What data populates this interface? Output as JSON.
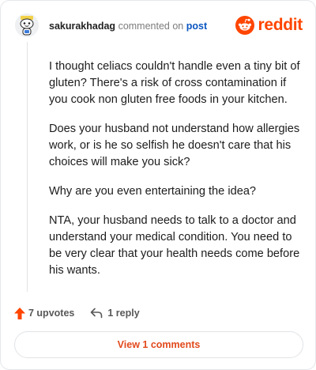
{
  "comment": {
    "author": "sakurakhadag",
    "action_text": "commented on",
    "post_link": "post",
    "avatar_icon": "snoo-avatar",
    "brand": {
      "name": "reddit",
      "color": "#ff4500"
    },
    "paragraphs": [
      "I thought celiacs couldn't handle even a tiny bit of gluten? There's a risk of cross contamination if you cook non gluten free foods in your kitchen.",
      "Does your husband not understand how allergies work, or is he so selfish he doesn't care that his choices will make you sick?",
      "Why are you even entertaining the idea?",
      "NTA, your husband needs to talk to a doctor and understand your medical condition. You need to be very clear that your health needs come before his wants."
    ]
  },
  "actions": {
    "upvotes_label": "7 upvotes",
    "upvote_icon": "upvote-arrow-icon",
    "upvote_color": "#ff4500",
    "reply_label": "1 reply",
    "reply_icon": "reply-arrow-icon"
  },
  "footer": {
    "view_comments_label": "View 1 comments",
    "accent": "#e24a1c"
  }
}
